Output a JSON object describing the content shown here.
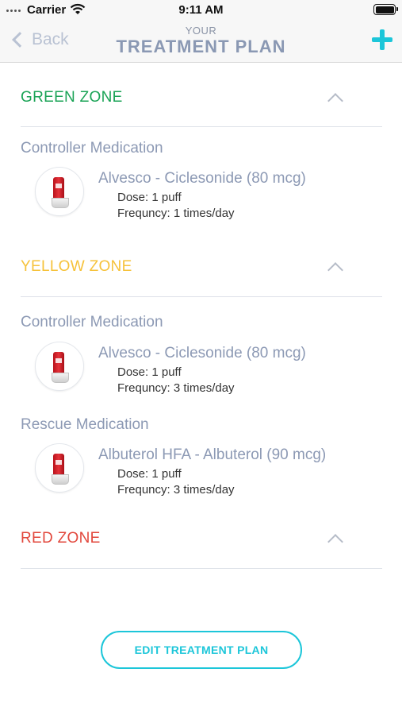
{
  "status_bar": {
    "carrier": "Carrier",
    "time": "9:11 AM"
  },
  "nav": {
    "back_label": "Back",
    "title_small": "YOUR",
    "title_big": "TREATMENT PLAN"
  },
  "colors": {
    "accent": "#1cc6d9",
    "green_zone": "#1aa356",
    "yellow_zone": "#f6c23a",
    "red_zone": "#e2483d",
    "muted_text": "#8c99b4"
  },
  "zones": [
    {
      "title": "GREEN ZONE",
      "groups": [
        {
          "category": "Controller Medication",
          "items": [
            {
              "name": "Alvesco - Ciclesonide (80 mcg)",
              "dose": "Dose: 1 puff",
              "frequency": "Frequncy: 1 times/day"
            }
          ]
        }
      ]
    },
    {
      "title": "YELLOW ZONE",
      "groups": [
        {
          "category": "Controller Medication",
          "items": [
            {
              "name": "Alvesco - Ciclesonide (80 mcg)",
              "dose": "Dose: 1 puff",
              "frequency": "Frequncy: 3 times/day"
            }
          ]
        },
        {
          "category": "Rescue Medication",
          "items": [
            {
              "name": "Albuterol HFA - Albuterol (90 mcg)",
              "dose": "Dose: 1 puff",
              "frequency": "Frequncy: 3 times/day"
            }
          ]
        }
      ]
    },
    {
      "title": "RED ZONE",
      "groups": []
    }
  ],
  "edit_button_label": "EDIT TREATMENT PLAN"
}
